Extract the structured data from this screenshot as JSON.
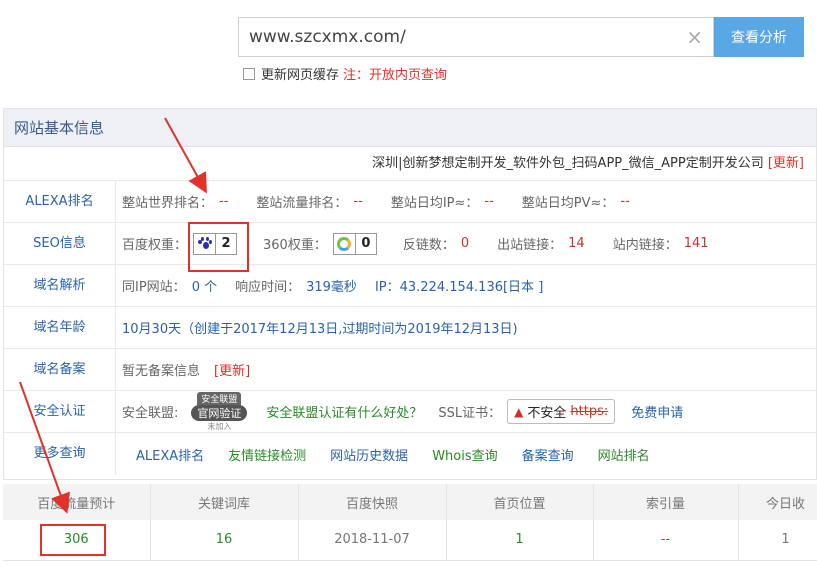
{
  "search": {
    "value": "www.szcxmx.com/",
    "clear_icon": "close-icon",
    "button_label": "查看分析",
    "cache_label": "更新网页缓存",
    "cache_note": "注：开放内页查询"
  },
  "panel": {
    "title": "网站基本信息",
    "company": "深圳|创新梦想定制开发_软件外包_扫码APP_微信_APP定制开发公司",
    "company_update": "[更新]"
  },
  "rows": {
    "alexa": {
      "label": "ALEXA排名",
      "world_rank_label": "整站世界排名：",
      "world_rank": "--",
      "traffic_rank_label": "整站流量排名：",
      "traffic_rank": "--",
      "daily_ip_label": "整站日均IP≈：",
      "daily_ip": "--",
      "daily_pv_label": "整站日均PV≈：",
      "daily_pv": "--"
    },
    "seo": {
      "label": "SEO信息",
      "baidu_label": "百度权重：",
      "baidu_value": "2",
      "w360_label": "360权重：",
      "w360_value": "0",
      "backlinks_label": "反链数：",
      "backlinks": "0",
      "outlinks_label": "出站链接：",
      "outlinks": "14",
      "inlinks_label": "站内链接：",
      "inlinks": "141"
    },
    "dns": {
      "label": "域名解析",
      "same_ip_label": "同IP网站：",
      "same_ip": "0 个",
      "resp_label": "响应时间：",
      "resp": "319毫秒",
      "ip": "IP：43.224.154.136[日本 ]"
    },
    "age": {
      "label": "域名年龄",
      "text": "10月30天（创建于2017年12月13日,过期时间为2019年12月13日)"
    },
    "icp": {
      "label": "域名备案",
      "text": "暂无备案信息",
      "update": "[更新]"
    },
    "security": {
      "label": "安全认证",
      "alliance_label": "安全联盟:",
      "seal_top": "安全联盟",
      "seal_main": "官网验证",
      "seal_sub": "未加入",
      "alliance_link": "安全联盟认证有什么好处？",
      "ssl_label": "SSL证书：",
      "ssl_status": "不安全",
      "ssl_https": "https:",
      "ssl_apply": "免费申请"
    },
    "more": {
      "label": "更多查询",
      "links": [
        "ALEXA排名",
        "友情链接检测",
        "网站历史数据",
        "Whois查询",
        "备案查询",
        "网站排名"
      ]
    }
  },
  "stats": {
    "headers": [
      "百度流量预计",
      "关键词库",
      "百度快照",
      "首页位置",
      "索引量",
      "今日收"
    ],
    "values": [
      "306",
      "16",
      "2018-11-07",
      "1",
      "--",
      "1"
    ]
  },
  "colors": {
    "accent": "#5aa7e6",
    "red": "#e0322a",
    "blue": "#2a62a8",
    "green": "#2a8a2a"
  }
}
